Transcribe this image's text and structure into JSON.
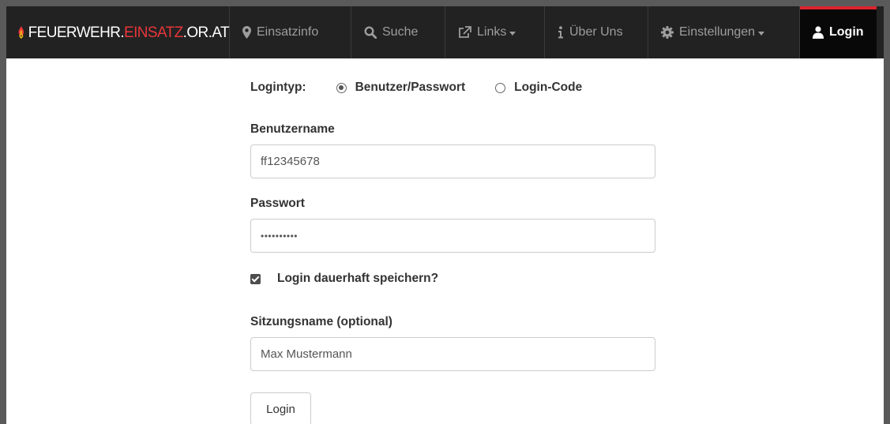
{
  "brand": {
    "part1": "FEUERWEHR.",
    "part2": "EINSATZ",
    "part3": ".OR.AT"
  },
  "nav": {
    "einsatzinfo": "Einsatzinfo",
    "suche": "Suche",
    "links": "Links",
    "ueber_uns": "Über Uns",
    "einstellungen": "Einstellungen",
    "login": "Login"
  },
  "form": {
    "logintyp_label": "Logintyp:",
    "login_types": [
      {
        "label": "Benutzer/Passwort",
        "selected": true
      },
      {
        "label": "Login-Code",
        "selected": false
      }
    ],
    "username_label": "Benutzername",
    "username_value": "ff12345678",
    "password_label": "Passwort",
    "password_value": "••••••••••",
    "remember_label": "Login dauerhaft speichern?",
    "remember_checked": true,
    "session_label": "Sitzungsname (optional)",
    "session_value": "Max Mustermann",
    "submit_label": "Login"
  },
  "colors": {
    "navbar_bg": "#222222",
    "active_bg": "#080808",
    "accent_red": "#d9232d",
    "brand_orange": "#f7a21a"
  }
}
